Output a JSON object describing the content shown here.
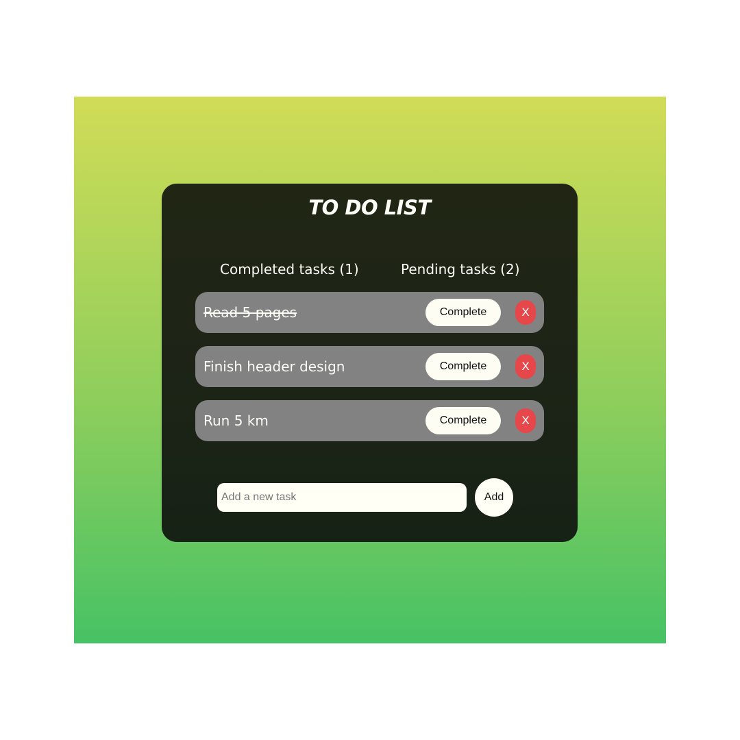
{
  "app": {
    "title": "TO DO LIST"
  },
  "counters": {
    "completed_label": "Completed tasks (1)",
    "pending_label": "Pending tasks (2)"
  },
  "tasks": [
    {
      "text": "Read 5 pages",
      "completed": true,
      "complete_label": "Complete",
      "delete_label": "X"
    },
    {
      "text": "Finish header design",
      "completed": false,
      "complete_label": "Complete",
      "delete_label": "X"
    },
    {
      "text": "Run 5 km",
      "completed": false,
      "complete_label": "Complete",
      "delete_label": "X"
    }
  ],
  "new_task": {
    "placeholder": "Add a new task",
    "value": "",
    "add_label": "Add"
  },
  "colors": {
    "background_gradient": [
      "#d1dc57",
      "#47c264"
    ],
    "card": "#1d2417",
    "task_item": "#828282",
    "button_light": "#fdfdf4",
    "delete_red": "#e5474b",
    "text_light": "#fdfdf7"
  }
}
